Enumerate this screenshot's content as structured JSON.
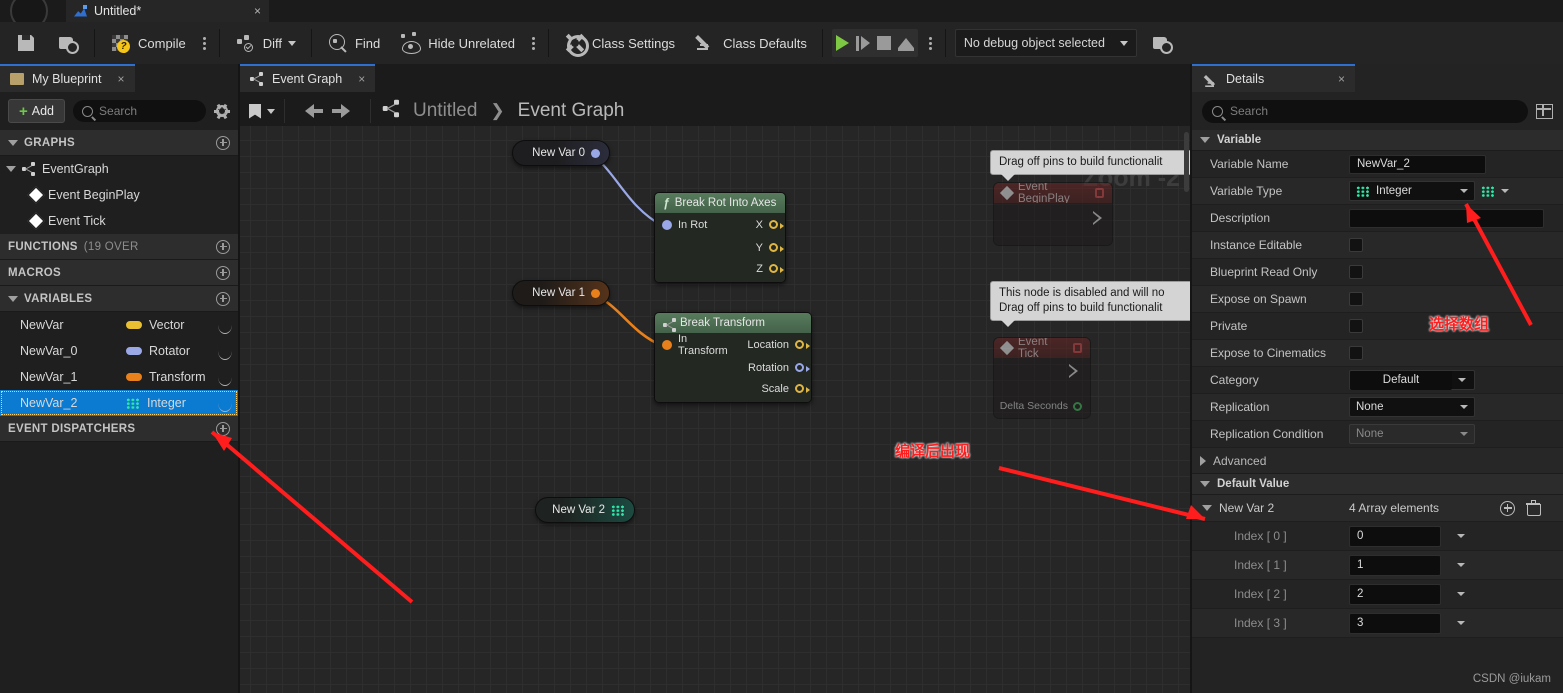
{
  "titlebar": {
    "document_tab_label": "Untitled*",
    "close_label": "×",
    "bp_icon": "blueprint-icon",
    "ue_logo": "unreal-logo-icon"
  },
  "toolbar": {
    "save_label": "",
    "browse_label": "",
    "compile_label": "Compile",
    "diff_label": "Diff",
    "find_label": "Find",
    "hide_unrelated_label": "Hide Unrelated",
    "class_settings_label": "Class Settings",
    "class_defaults_label": "Class Defaults",
    "debug_object_value": "No debug object selected",
    "play_icon": "play-icon",
    "step_icon": "step-icon",
    "stop_icon": "stop-icon",
    "eject_icon": "eject-icon"
  },
  "my_blueprint": {
    "tab_label": "My Blueprint",
    "tab_close": "×",
    "add_label": "Add",
    "search_placeholder": "Search",
    "sections": {
      "graphs": "GRAPHS",
      "functions": "FUNCTIONS",
      "functions_sub": "(19 OVER",
      "macros": "MACROS",
      "variables": "VARIABLES",
      "event_dispatchers": "EVENT DISPATCHERS"
    },
    "graph_tree": [
      {
        "label": "EventGraph",
        "icon": "graph-icon"
      },
      {
        "label": "Event BeginPlay",
        "icon": "event-diamond-icon"
      },
      {
        "label": "Event Tick",
        "icon": "event-diamond-icon"
      }
    ],
    "variables": [
      {
        "name": "NewVar",
        "type": "Vector",
        "color": "#e8c032",
        "selected": false
      },
      {
        "name": "NewVar_0",
        "type": "Rotator",
        "color": "#9aa8e8",
        "selected": false
      },
      {
        "name": "NewVar_1",
        "type": "Transform",
        "color": "#e8801b",
        "selected": false
      },
      {
        "name": "NewVar_2",
        "type": "Integer",
        "color": "#2ee6a8",
        "selected": true
      }
    ]
  },
  "graph": {
    "tab_label": "Event Graph",
    "tab_close": "×",
    "breadcrumb_root": "Untitled",
    "breadcrumb_sep": "❯",
    "breadcrumb_current": "Event Graph",
    "zoom_label": "Zoom -2",
    "nodes": {
      "var_rot": {
        "title": "New Var 0"
      },
      "var_transform": {
        "title": "New Var 1"
      },
      "var_int": {
        "title": "New Var 2"
      },
      "break_rot": {
        "title": "Break Rot Into Axes",
        "input": "In Rot",
        "outputs": [
          "X",
          "Y",
          "Z"
        ]
      },
      "break_transform": {
        "title": "Break Transform",
        "input": "In Transform",
        "outputs": [
          "Location",
          "Rotation",
          "Scale"
        ]
      },
      "event_begin_play": {
        "title": "Event BeginPlay"
      },
      "event_tick": {
        "title": "Event Tick",
        "pin": "Delta Seconds"
      }
    },
    "tooltips": [
      {
        "line1": "Drag off pins to build functionalit",
        "line2": ""
      },
      {
        "line1": "This node is disabled and will no",
        "line2": "Drag off pins to build functionalit"
      }
    ]
  },
  "details": {
    "tab_label": "Details",
    "tab_close": "×",
    "search_placeholder": "Search",
    "variable_section": "Variable",
    "default_value_section": "Default Value",
    "advanced_section": "Advanced",
    "rows": [
      {
        "label": "Variable Name",
        "value": "NewVar_2"
      },
      {
        "label": "Variable Type",
        "value": "Integer"
      },
      {
        "label": "Description",
        "value": ""
      },
      {
        "label": "Instance Editable",
        "value": ""
      },
      {
        "label": "Blueprint Read Only",
        "value": ""
      },
      {
        "label": "Expose on Spawn",
        "value": ""
      },
      {
        "label": "Private",
        "value": ""
      },
      {
        "label": "Expose to Cinematics",
        "value": ""
      },
      {
        "label": "Category",
        "value": "Default"
      },
      {
        "label": "Replication",
        "value": "None"
      },
      {
        "label": "Replication Condition",
        "value": "None"
      }
    ],
    "array": {
      "name": "New Var 2",
      "count_label": "4 Array elements",
      "elements": [
        {
          "index_label": "Index [ 0 ]",
          "value": "0"
        },
        {
          "index_label": "Index [ 1 ]",
          "value": "1"
        },
        {
          "index_label": "Index [ 2 ]",
          "value": "2"
        },
        {
          "index_label": "Index [ 3 ]",
          "value": "3"
        }
      ]
    },
    "watermark": "CSDN @iukam"
  },
  "annotations": [
    {
      "text": "选择数组"
    },
    {
      "text": "编译后出现"
    }
  ],
  "colors": {
    "accent": "#2f6fd0",
    "selection": "#0b7ad1",
    "annotation": "#ff1d1d",
    "integer": "#2ee6a8",
    "play": "#7ec943"
  }
}
